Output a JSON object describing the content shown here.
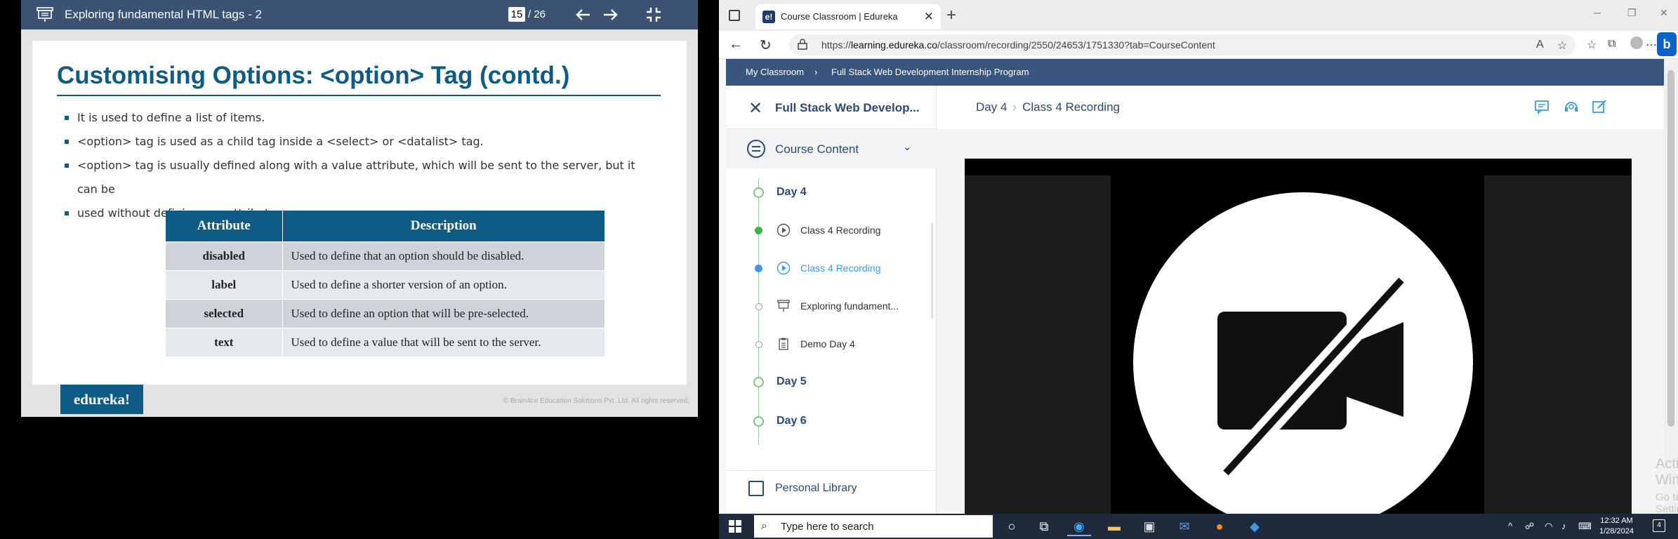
{
  "viewer": {
    "title": "Exploring fundamental HTML tags - 2",
    "page_current": "15",
    "page_total": "/ 26"
  },
  "slide": {
    "title": "Customising Options: <option>  Tag (contd.)",
    "bullets": [
      "It is used to define a list of items.",
      "<option> tag is used as a child tag inside a <select> or <datalist> tag.",
      "<option> tag is usually defined along with a value attribute, which will be sent to the server, but it can be",
      "used without defining any attributes."
    ],
    "table": {
      "headers": [
        "Attribute",
        "Description"
      ],
      "rows": [
        [
          "disabled",
          "Used to define that an option should be disabled."
        ],
        [
          "label",
          "Used to define a shorter version of an option."
        ],
        [
          "selected",
          "Used to define an option that will be pre-selected."
        ],
        [
          "text",
          "Used to define a value that will be sent to the server."
        ]
      ]
    },
    "logo": "edureka!",
    "copyright": "© Brain4ce Education Solutions Pvt. Ltd. All rights reserved."
  },
  "browser": {
    "tab_title": "Course Classroom | Edureka",
    "tab_favicon": "e!",
    "url_host": "learning.edureka.co",
    "url_prefix": "https://",
    "url_path": "/classroom/recording/2550/24653/1751330?tab=CourseContent",
    "bing_label": "b"
  },
  "site": {
    "breadcrumb": [
      "My Classroom",
      "Full Stack Web Development Internship Program"
    ],
    "course_title": "Full Stack Web Develop...",
    "course_content_label": "Course Content",
    "timeline": [
      {
        "type": "day",
        "label": "Day 4"
      },
      {
        "type": "video",
        "label": "Class 4 Recording",
        "state": "done"
      },
      {
        "type": "video",
        "label": "Class 4 Recording",
        "state": "active"
      },
      {
        "type": "slides",
        "label": "Exploring fundament...",
        "state": "todo"
      },
      {
        "type": "doc",
        "label": "Demo Day 4",
        "state": "todo"
      },
      {
        "type": "day",
        "label": "Day 5"
      },
      {
        "type": "day",
        "label": "Day 6"
      }
    ],
    "personal_library": "Personal Library",
    "main_crumb_day": "Day 4",
    "main_crumb_item": "Class 4 Recording",
    "icons": [
      "comment-icon",
      "support-icon",
      "edit-icon"
    ]
  },
  "watermark": {
    "line1": "Activate Windows",
    "line2": "Go to Settings to activate Windows."
  },
  "taskbar": {
    "search_placeholder": "Type here to search",
    "time": "12:32 AM",
    "date": "1/28/2024",
    "notif_count": "4"
  },
  "colors": {
    "edureka_blue": "#0e5c86",
    "site_nav": "#37557f",
    "active_blue": "#3a9ae8",
    "done_green": "#3ab54a"
  }
}
